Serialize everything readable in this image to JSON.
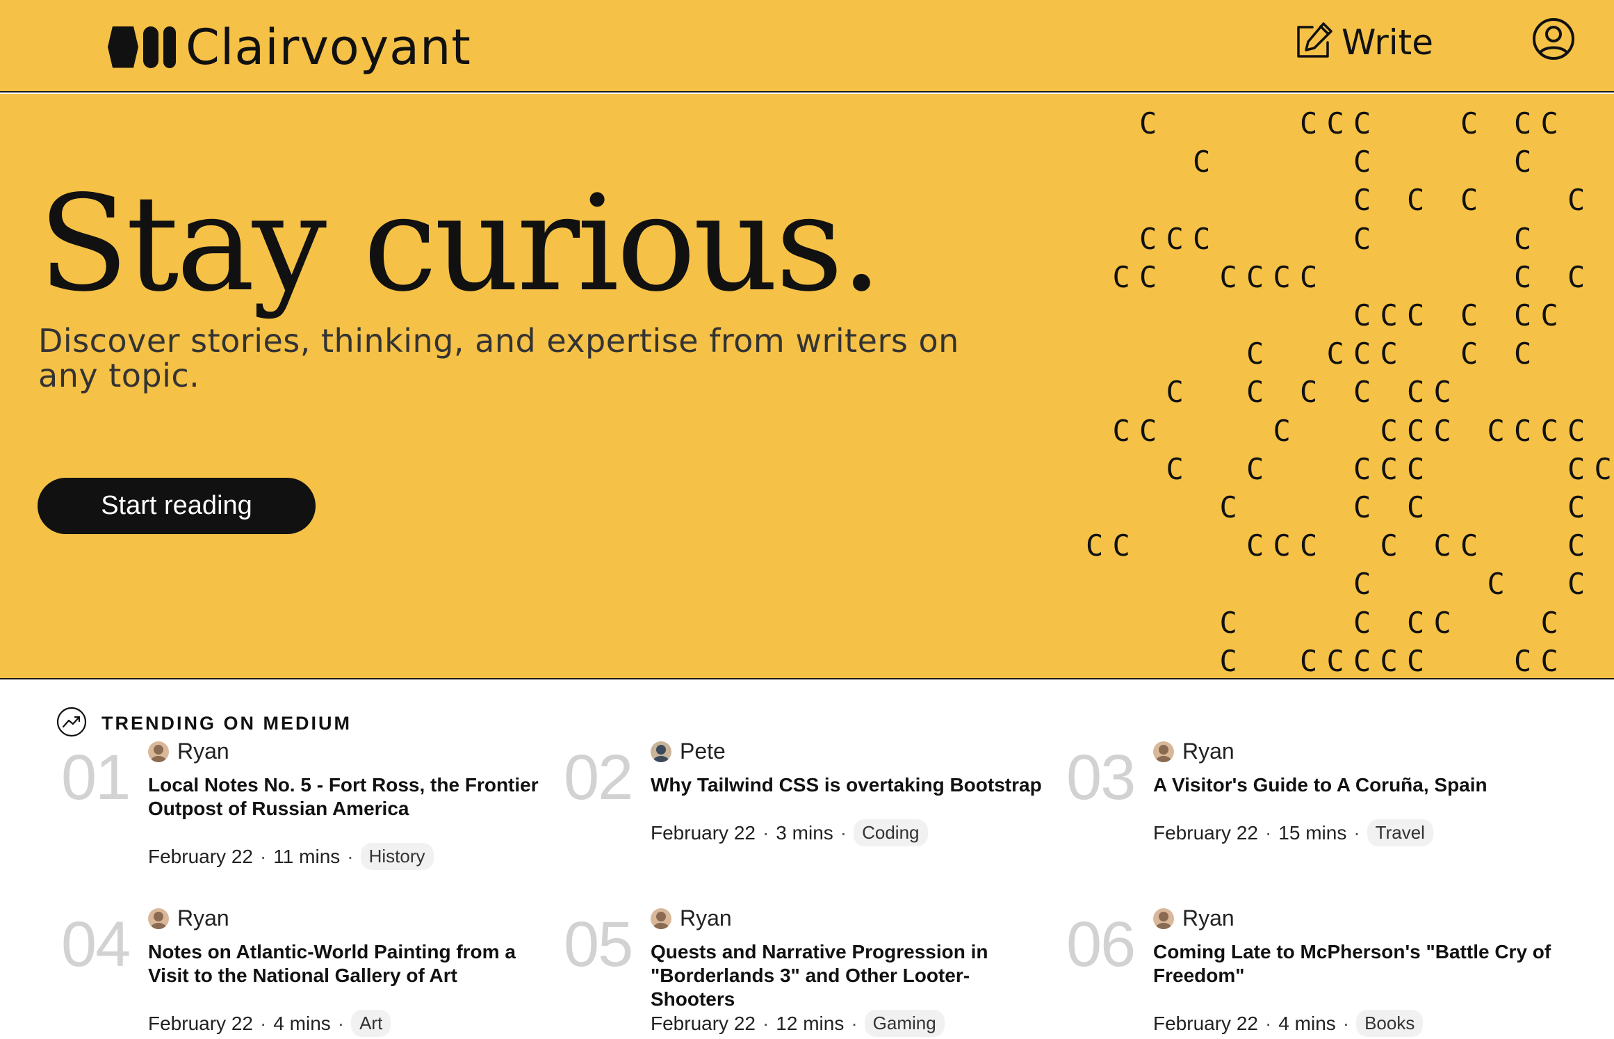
{
  "header": {
    "brand": "Clairvoyant",
    "write_label": "Write"
  },
  "hero": {
    "title": "Stay curious.",
    "subtitle": "Discover stories, thinking, and expertise from writers on any topic.",
    "cta_label": "Start reading",
    "pattern_glyph": "C",
    "pattern_rows": [
      "..C.....CCC...C.CC.....",
      "....C.....C.....C......",
      "..........C.C.C...C.C..",
      "..CCC.....C.....C.....C",
      ".CC..CCCC.......C.C.C.C",
      "..........CCC.C.CC..C..",
      "......C..CCC..C.C...C..",
      "...C..C.C.C.CC........C",
      ".CC....C...CCC.CCCC....",
      "...C..C...CCC.....CCCC.",
      ".....C....C.C.....C.C..",
      "CC....CCC..C.CC...C....",
      "..........C....C..C....",
      ".....C....C.CC...C..CC.",
      ".....C..CCCCC...CC....."
    ],
    "colors": {
      "background": "#F5C146",
      "ink": "#111111"
    }
  },
  "trending": {
    "heading": "TRENDING ON MEDIUM",
    "items": [
      {
        "number": "01",
        "author": "Ryan",
        "title": "Local Notes No. 5 - Fort Ross, the Frontier Outpost of Russian America",
        "date": "February 22",
        "read_time": "11 mins",
        "tag": "History"
      },
      {
        "number": "02",
        "author": "Pete",
        "title": "Why Tailwind CSS is overtaking Bootstrap",
        "date": "February 22",
        "read_time": "3 mins",
        "tag": "Coding"
      },
      {
        "number": "03",
        "author": "Ryan",
        "title": "A Visitor's Guide to A Coruña, Spain",
        "date": "February 22",
        "read_time": "15 mins",
        "tag": "Travel"
      },
      {
        "number": "04",
        "author": "Ryan",
        "title": "Notes on Atlantic-World Painting from a Visit to the National Gallery of Art",
        "date": "February 22",
        "read_time": "4 mins",
        "tag": "Art"
      },
      {
        "number": "05",
        "author": "Ryan",
        "title": "Quests and Narrative Progression in \"Borderlands 3\" and Other Looter-Shooters",
        "date": "February 22",
        "read_time": "12 mins",
        "tag": "Gaming"
      },
      {
        "number": "06",
        "author": "Ryan",
        "title": "Coming Late to McPherson's \"Battle Cry of Freedom\"",
        "date": "February 22",
        "read_time": "4 mins",
        "tag": "Books"
      }
    ],
    "separator": "·"
  },
  "icons": {
    "write": "pencil-square-icon",
    "account": "user-circle-icon",
    "trending": "trending-up-icon"
  }
}
